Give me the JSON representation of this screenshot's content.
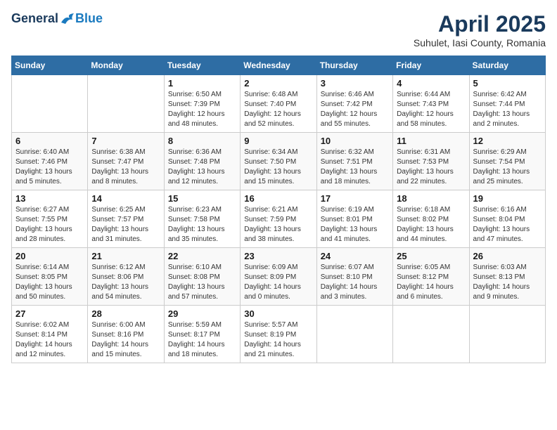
{
  "header": {
    "logo_general": "General",
    "logo_blue": "Blue",
    "month_title": "April 2025",
    "subtitle": "Suhulet, Iasi County, Romania"
  },
  "days_of_week": [
    "Sunday",
    "Monday",
    "Tuesday",
    "Wednesday",
    "Thursday",
    "Friday",
    "Saturday"
  ],
  "weeks": [
    [
      {
        "day": "",
        "info": ""
      },
      {
        "day": "",
        "info": ""
      },
      {
        "day": "1",
        "info": "Sunrise: 6:50 AM\nSunset: 7:39 PM\nDaylight: 12 hours\nand 48 minutes."
      },
      {
        "day": "2",
        "info": "Sunrise: 6:48 AM\nSunset: 7:40 PM\nDaylight: 12 hours\nand 52 minutes."
      },
      {
        "day": "3",
        "info": "Sunrise: 6:46 AM\nSunset: 7:42 PM\nDaylight: 12 hours\nand 55 minutes."
      },
      {
        "day": "4",
        "info": "Sunrise: 6:44 AM\nSunset: 7:43 PM\nDaylight: 12 hours\nand 58 minutes."
      },
      {
        "day": "5",
        "info": "Sunrise: 6:42 AM\nSunset: 7:44 PM\nDaylight: 13 hours\nand 2 minutes."
      }
    ],
    [
      {
        "day": "6",
        "info": "Sunrise: 6:40 AM\nSunset: 7:46 PM\nDaylight: 13 hours\nand 5 minutes."
      },
      {
        "day": "7",
        "info": "Sunrise: 6:38 AM\nSunset: 7:47 PM\nDaylight: 13 hours\nand 8 minutes."
      },
      {
        "day": "8",
        "info": "Sunrise: 6:36 AM\nSunset: 7:48 PM\nDaylight: 13 hours\nand 12 minutes."
      },
      {
        "day": "9",
        "info": "Sunrise: 6:34 AM\nSunset: 7:50 PM\nDaylight: 13 hours\nand 15 minutes."
      },
      {
        "day": "10",
        "info": "Sunrise: 6:32 AM\nSunset: 7:51 PM\nDaylight: 13 hours\nand 18 minutes."
      },
      {
        "day": "11",
        "info": "Sunrise: 6:31 AM\nSunset: 7:53 PM\nDaylight: 13 hours\nand 22 minutes."
      },
      {
        "day": "12",
        "info": "Sunrise: 6:29 AM\nSunset: 7:54 PM\nDaylight: 13 hours\nand 25 minutes."
      }
    ],
    [
      {
        "day": "13",
        "info": "Sunrise: 6:27 AM\nSunset: 7:55 PM\nDaylight: 13 hours\nand 28 minutes."
      },
      {
        "day": "14",
        "info": "Sunrise: 6:25 AM\nSunset: 7:57 PM\nDaylight: 13 hours\nand 31 minutes."
      },
      {
        "day": "15",
        "info": "Sunrise: 6:23 AM\nSunset: 7:58 PM\nDaylight: 13 hours\nand 35 minutes."
      },
      {
        "day": "16",
        "info": "Sunrise: 6:21 AM\nSunset: 7:59 PM\nDaylight: 13 hours\nand 38 minutes."
      },
      {
        "day": "17",
        "info": "Sunrise: 6:19 AM\nSunset: 8:01 PM\nDaylight: 13 hours\nand 41 minutes."
      },
      {
        "day": "18",
        "info": "Sunrise: 6:18 AM\nSunset: 8:02 PM\nDaylight: 13 hours\nand 44 minutes."
      },
      {
        "day": "19",
        "info": "Sunrise: 6:16 AM\nSunset: 8:04 PM\nDaylight: 13 hours\nand 47 minutes."
      }
    ],
    [
      {
        "day": "20",
        "info": "Sunrise: 6:14 AM\nSunset: 8:05 PM\nDaylight: 13 hours\nand 50 minutes."
      },
      {
        "day": "21",
        "info": "Sunrise: 6:12 AM\nSunset: 8:06 PM\nDaylight: 13 hours\nand 54 minutes."
      },
      {
        "day": "22",
        "info": "Sunrise: 6:10 AM\nSunset: 8:08 PM\nDaylight: 13 hours\nand 57 minutes."
      },
      {
        "day": "23",
        "info": "Sunrise: 6:09 AM\nSunset: 8:09 PM\nDaylight: 14 hours\nand 0 minutes."
      },
      {
        "day": "24",
        "info": "Sunrise: 6:07 AM\nSunset: 8:10 PM\nDaylight: 14 hours\nand 3 minutes."
      },
      {
        "day": "25",
        "info": "Sunrise: 6:05 AM\nSunset: 8:12 PM\nDaylight: 14 hours\nand 6 minutes."
      },
      {
        "day": "26",
        "info": "Sunrise: 6:03 AM\nSunset: 8:13 PM\nDaylight: 14 hours\nand 9 minutes."
      }
    ],
    [
      {
        "day": "27",
        "info": "Sunrise: 6:02 AM\nSunset: 8:14 PM\nDaylight: 14 hours\nand 12 minutes."
      },
      {
        "day": "28",
        "info": "Sunrise: 6:00 AM\nSunset: 8:16 PM\nDaylight: 14 hours\nand 15 minutes."
      },
      {
        "day": "29",
        "info": "Sunrise: 5:59 AM\nSunset: 8:17 PM\nDaylight: 14 hours\nand 18 minutes."
      },
      {
        "day": "30",
        "info": "Sunrise: 5:57 AM\nSunset: 8:19 PM\nDaylight: 14 hours\nand 21 minutes."
      },
      {
        "day": "",
        "info": ""
      },
      {
        "day": "",
        "info": ""
      },
      {
        "day": "",
        "info": ""
      }
    ]
  ]
}
